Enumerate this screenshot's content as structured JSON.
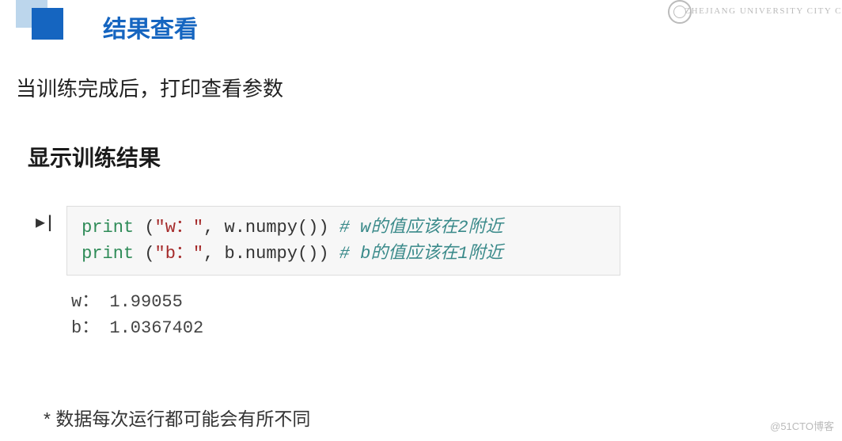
{
  "header": {
    "title": "结果查看",
    "university": "ZHEJIANG UNIVERSITY CITY C"
  },
  "description": "当训练完成后，打印查看参数",
  "subtitle": "显示训练结果",
  "code": {
    "line1": {
      "keyword": "print",
      "string": "\"w：\"",
      "rest": ", w.numpy())",
      "comment": "# w的值应该在2附近"
    },
    "line2": {
      "keyword": "print",
      "string": "\"b：\"",
      "rest": ", b.numpy())",
      "comment": "# b的值应该在1附近"
    }
  },
  "output": {
    "line1": "w： 1.99055",
    "line2": "b： 1.0367402"
  },
  "footnote": "* 数据每次运行都可能会有所不同",
  "watermark": "@51CTO博客"
}
